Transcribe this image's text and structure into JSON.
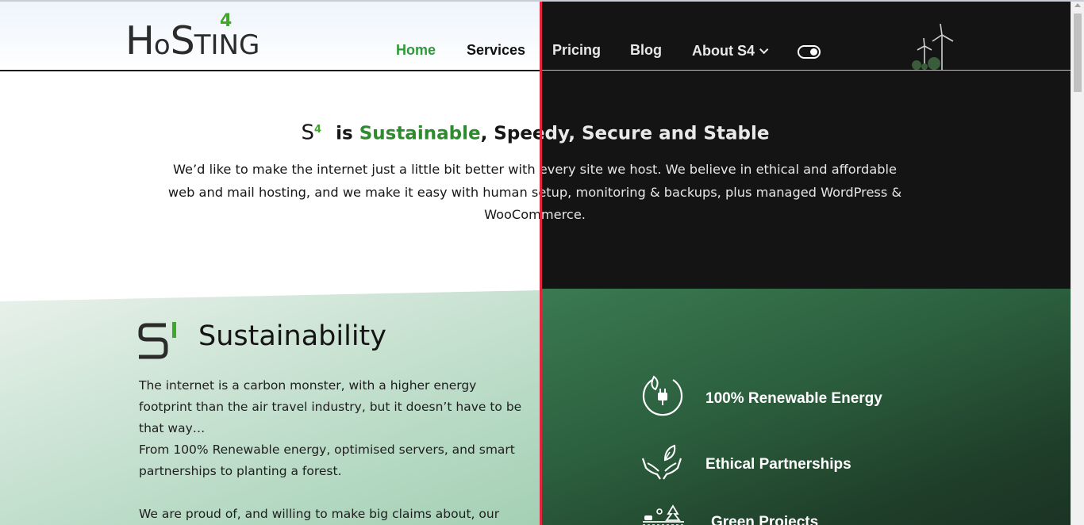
{
  "logo": {
    "text_h": "H",
    "text_o": "o",
    "text_s": "S",
    "text_ting": "TING",
    "superscript": "4",
    "brand_green": "#3fa72a"
  },
  "nav": {
    "items": [
      {
        "label": "Home",
        "active": true
      },
      {
        "label": "Services"
      },
      {
        "label": "Pricing"
      },
      {
        "label": "Blog"
      },
      {
        "label": "About S4",
        "has_dropdown": true
      }
    ],
    "theme_toggle": "dark-mode-toggle"
  },
  "hero": {
    "mark": "S",
    "mark_sup": "4",
    "title_is": "is",
    "title_green": "Sustainable",
    "title_rest": ", Speedy, Secure and Stable",
    "body_line1": "We’d like to make the internet just a little bit better with every site we host. We believe in ethical and affordable",
    "body_line2": "web and mail hosting, and we make it easy with human setup, monitoring & backups, plus managed WordPress &",
    "body_line3": "WooCommerce."
  },
  "sustainability": {
    "badge_letter": "S",
    "badge_number": "1",
    "title": "Sustainability",
    "para1": "The internet is a carbon monster, with a higher energy footprint than the air travel industry, but it doesn’t have to be that way…",
    "para2": "From 100% Renewable energy, optimised servers, and smart partnerships to planting a forest.",
    "para3": "We are proud of, and willing to make big claims about, our ethical"
  },
  "features": [
    {
      "label": "100% Renewable Energy",
      "icon": "renewable-plug-icon"
    },
    {
      "label": "Ethical Partnerships",
      "icon": "hands-leaf-icon"
    },
    {
      "label": "Green Projects",
      "icon": "green-projects-icon"
    }
  ],
  "colors": {
    "accent_green": "#2e9a3a",
    "split_divider": "#e3243c",
    "dark_bg": "#141414",
    "dark_green": "#2b5e3d"
  }
}
